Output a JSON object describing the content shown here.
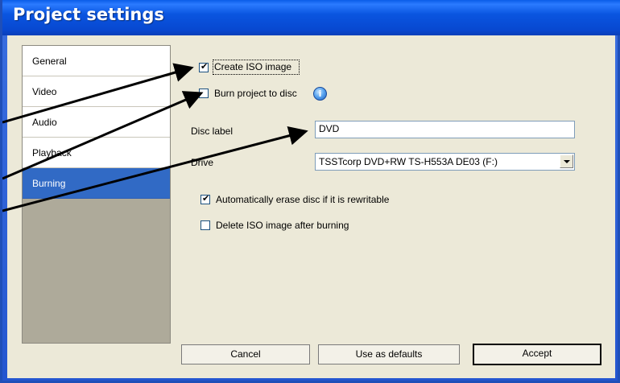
{
  "window": {
    "title": "Project settings"
  },
  "sidebar": {
    "items": [
      {
        "label": "General"
      },
      {
        "label": "Video"
      },
      {
        "label": "Audio"
      },
      {
        "label": "Playback"
      },
      {
        "label": "Burning",
        "selected": true
      }
    ]
  },
  "burning": {
    "create_iso": {
      "label": "Create ISO image",
      "checked": true
    },
    "burn_to_disc": {
      "label": "Burn project to disc",
      "checked": false
    },
    "info_icon": "info-icon",
    "disc_label": {
      "label": "Disc label",
      "value": "DVD"
    },
    "drive": {
      "label": "Drive",
      "value": "TSSTcorp DVD+RW TS-H553A DE03 (F:)"
    },
    "auto_erase": {
      "label": "Automatically erase disc if it is rewritable",
      "checked": true
    },
    "delete_iso": {
      "label": "Delete ISO image after burning",
      "checked": false
    }
  },
  "buttons": {
    "cancel": "Cancel",
    "defaults": "Use as defaults",
    "accept": "Accept"
  },
  "colors": {
    "titlebar": "#0a55e0",
    "selection": "#316ac5",
    "dialog_bg": "#ece9d8",
    "annotation_arrows": "#000000"
  }
}
